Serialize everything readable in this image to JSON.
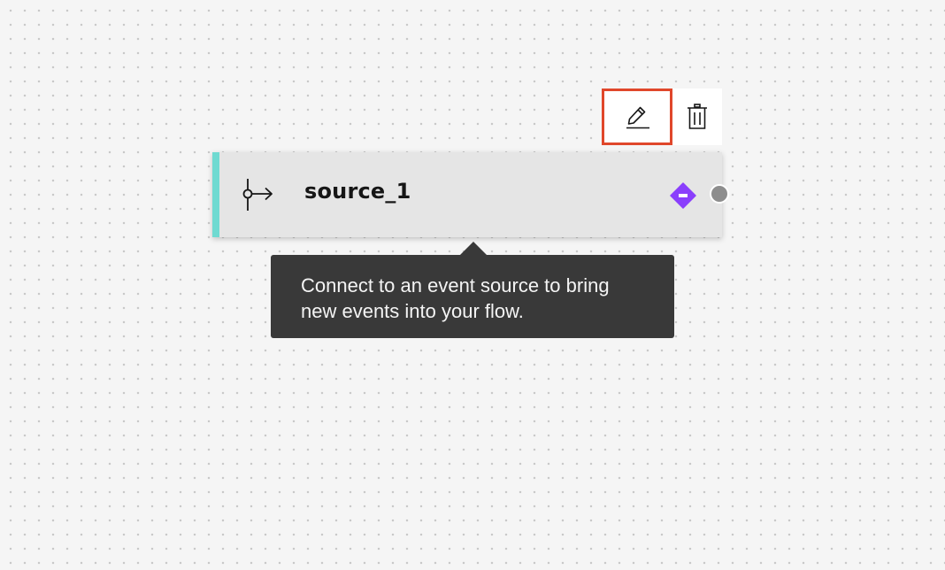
{
  "toolbar": {
    "edit_icon": "pencil-icon",
    "delete_icon": "trash-icon",
    "highlight_color": "#e0472b"
  },
  "node": {
    "title": "source_1",
    "type_icon": "event-source-icon",
    "status_icon": "minus-diamond-icon",
    "accent_color": "#6fdad1",
    "status_color": "#8a3ffc"
  },
  "tooltip": {
    "text": "Connect to an event source to bring new events into your flow."
  }
}
